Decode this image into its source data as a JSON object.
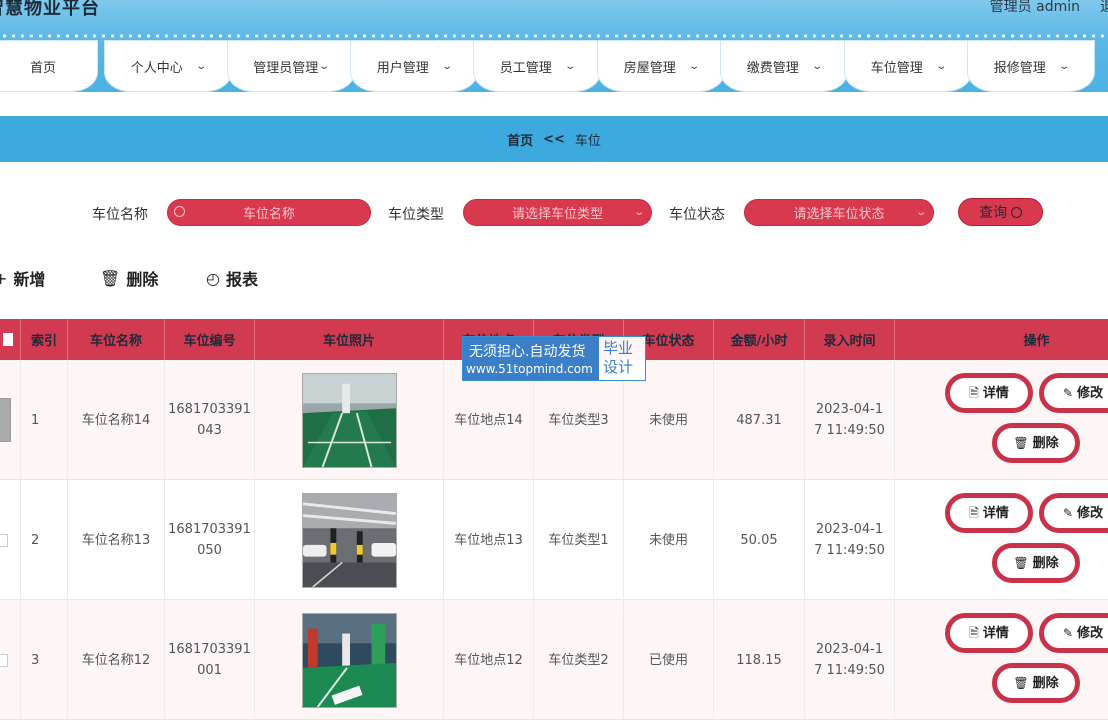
{
  "header": {
    "brand": "智慧物业平台",
    "admin_text": "管理员 admin",
    "logout_text": "退"
  },
  "nav": [
    {
      "label": "首页"
    },
    {
      "label": "个人中心"
    },
    {
      "label": "管理员管理"
    },
    {
      "label": "用户管理"
    },
    {
      "label": "员工管理"
    },
    {
      "label": "房屋管理"
    },
    {
      "label": "缴费管理"
    },
    {
      "label": "车位管理"
    },
    {
      "label": "报修管理"
    }
  ],
  "breadcrumb": {
    "home": "首页",
    "sep": "<<",
    "current": "车位"
  },
  "search": {
    "name_label": "车位名称",
    "name_placeholder": "车位名称",
    "type_label": "车位类型",
    "type_placeholder": "请选择车位类型",
    "status_label": "车位状态",
    "status_placeholder": "请选择车位状态",
    "query_button": "查询"
  },
  "toolbar": {
    "add": "新增",
    "delete": "删除",
    "report": "报表"
  },
  "table": {
    "headers": [
      "",
      "索引",
      "车位名称",
      "车位编号",
      "车位照片",
      "车位地点",
      "车位类型",
      "车位状态",
      "金额/小时",
      "录入时间",
      "操作"
    ],
    "rows": [
      {
        "index": "1",
        "name": "车位名称14",
        "code_line1": "1681703391",
        "code_line2": "043",
        "location": "车位地点14",
        "type": "车位类型3",
        "status": "未使用",
        "price": "487.31",
        "time_line1": "2023-04-1",
        "time_line2": "7 11:49:50"
      },
      {
        "index": "2",
        "name": "车位名称13",
        "code_line1": "1681703391",
        "code_line2": "050",
        "location": "车位地点13",
        "type": "车位类型1",
        "status": "未使用",
        "price": "50.05",
        "time_line1": "2023-04-1",
        "time_line2": "7 11:49:50"
      },
      {
        "index": "3",
        "name": "车位名称12",
        "code_line1": "1681703391",
        "code_line2": "001",
        "location": "车位地点12",
        "type": "车位类型2",
        "status": "已使用",
        "price": "118.15",
        "time_line1": "2023-04-1",
        "time_line2": "7 11:49:50"
      }
    ],
    "actions": {
      "detail": "详情",
      "edit": "修改",
      "delete": "删除"
    }
  },
  "watermark": {
    "line1": "无须担心.自动发货",
    "line2": "www.51topmind.com",
    "right1": "毕业",
    "right2": "设计"
  },
  "colors": {
    "header_blue": "#49b0e3",
    "accent_red": "#d9394f",
    "table_head": "#d23a51"
  }
}
